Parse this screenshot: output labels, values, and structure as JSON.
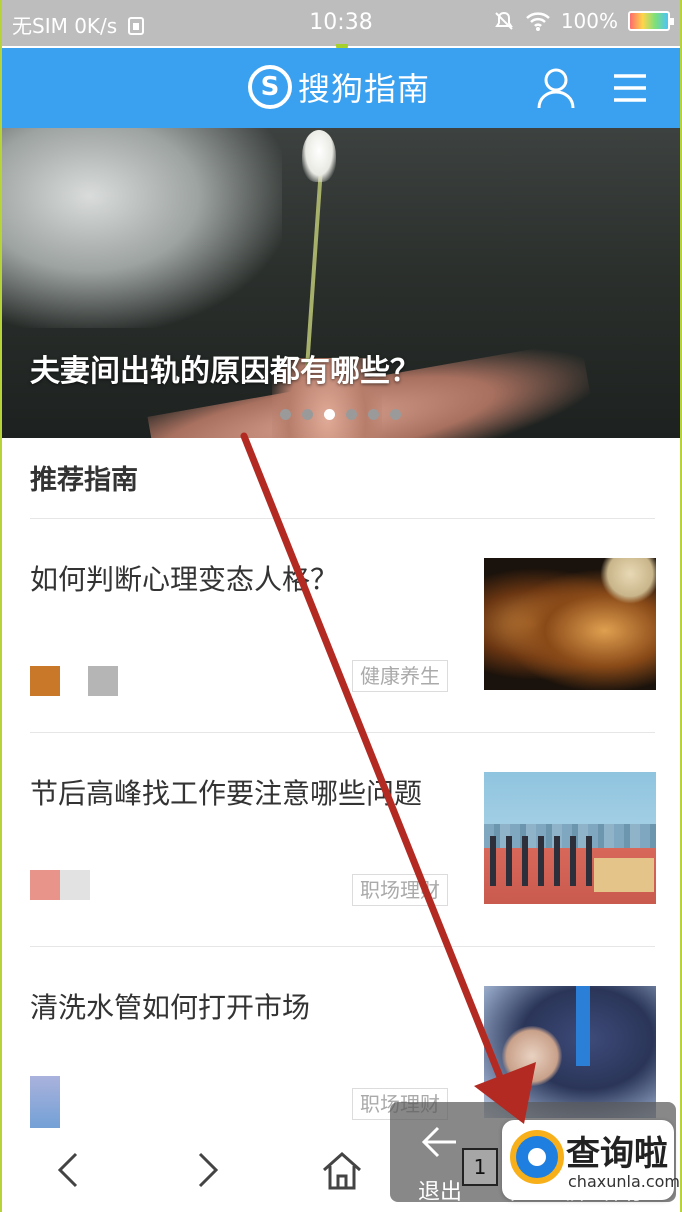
{
  "status_bar": {
    "carrier": "无SIM 0K/s",
    "sim_icon": "sim-icon",
    "time": "10:38",
    "battery": "100%"
  },
  "header": {
    "logo_mark": "S",
    "logo_text": "搜狗指南",
    "accent_color": "#3aa0f0"
  },
  "banner": {
    "title": "夫妻间出轨的原因都有哪些？",
    "slide_count": 6,
    "active_slide": 3
  },
  "section": {
    "title": "推荐指南"
  },
  "items": [
    {
      "title": "如何判断心理变态人格？",
      "tag": "健康养生"
    },
    {
      "title": "节后高峰找工作要注意哪些问题",
      "tag": "职场理财"
    },
    {
      "title": "清洗水管如何打开市场",
      "tag": "职场理财"
    }
  ],
  "toolbar": {
    "back_icon": "chevron-left-icon",
    "forward_icon": "chevron-right-icon",
    "home_icon": "home-icon"
  },
  "overlay": {
    "exit_label": "退出",
    "page_number": "1",
    "partial_label_1": "下",
    "partial_label_2": "屏",
    "partial_label_3": "保存"
  },
  "watermark": {
    "text": "查询啦",
    "sub": "chaxunla.com"
  }
}
